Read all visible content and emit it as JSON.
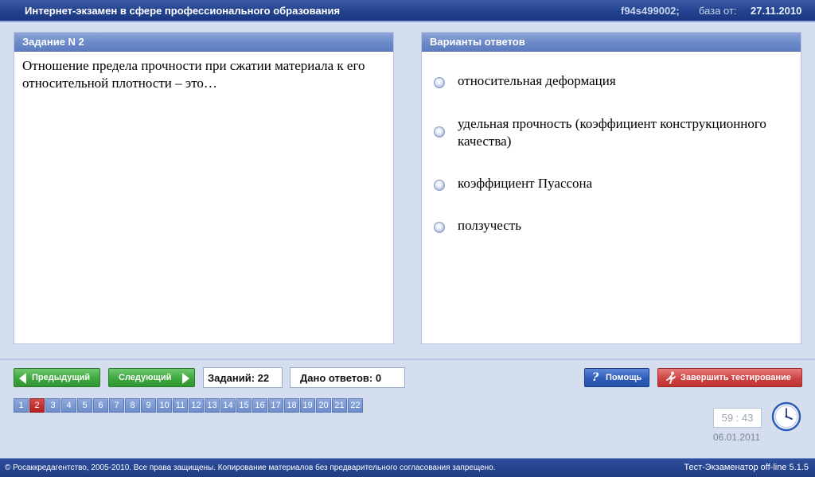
{
  "titlebar": {
    "app_title": "Интернет-экзамен в сфере профессионального образования",
    "session_id": "f94s499002;",
    "base_label": "база от:",
    "base_date": "27.11.2010"
  },
  "task_panel": {
    "header": "Задание N 2",
    "question": "Отношение предела прочности при сжатии материала к его относительной плотности – это…"
  },
  "answers_panel": {
    "header": "Варианты ответов",
    "options": [
      {
        "label": "относительная деформация"
      },
      {
        "label": "удельная прочность (коэффициент конструкционного качества)"
      },
      {
        "label": "коэффициент Пуассона"
      },
      {
        "label": "ползучесть"
      }
    ]
  },
  "navigation": {
    "prev_label": "Предыдущий",
    "next_label": "Следующий",
    "tasks_count": "Заданий: 22",
    "answers_given": "Дано ответов: 0",
    "help_label": "Помощь",
    "finish_label": "Завершить тестирование"
  },
  "pages": {
    "numbers": [
      "1",
      "2",
      "3",
      "4",
      "5",
      "6",
      "7",
      "8",
      "9",
      "10",
      "11",
      "12",
      "13",
      "14",
      "15",
      "16",
      "17",
      "18",
      "19",
      "20",
      "21",
      "22"
    ],
    "current": "2"
  },
  "timer": {
    "remaining": "59 : 43",
    "date": "06.01.2011"
  },
  "footer": {
    "copyright": "© Росаккредагентство, 2005-2010. Все права защищены. Копирование материалов без предварительного согласования запрещено.",
    "version": "Тест-Экзаменатор off-line 5.1.5"
  },
  "colors": {
    "title_bar": "#23428e",
    "panel_header": "#6f8cca",
    "nav_button": "#3ea73e",
    "help_button": "#2f5cb9",
    "finish_button": "#cf4343",
    "current_page": "#b32020",
    "background": "#d5deef"
  },
  "icons": {
    "prev": "triangle-left-icon",
    "next": "triangle-right-icon",
    "help": "question-mark-icon",
    "finish": "running-man-exit-icon",
    "clock": "clock-icon"
  }
}
